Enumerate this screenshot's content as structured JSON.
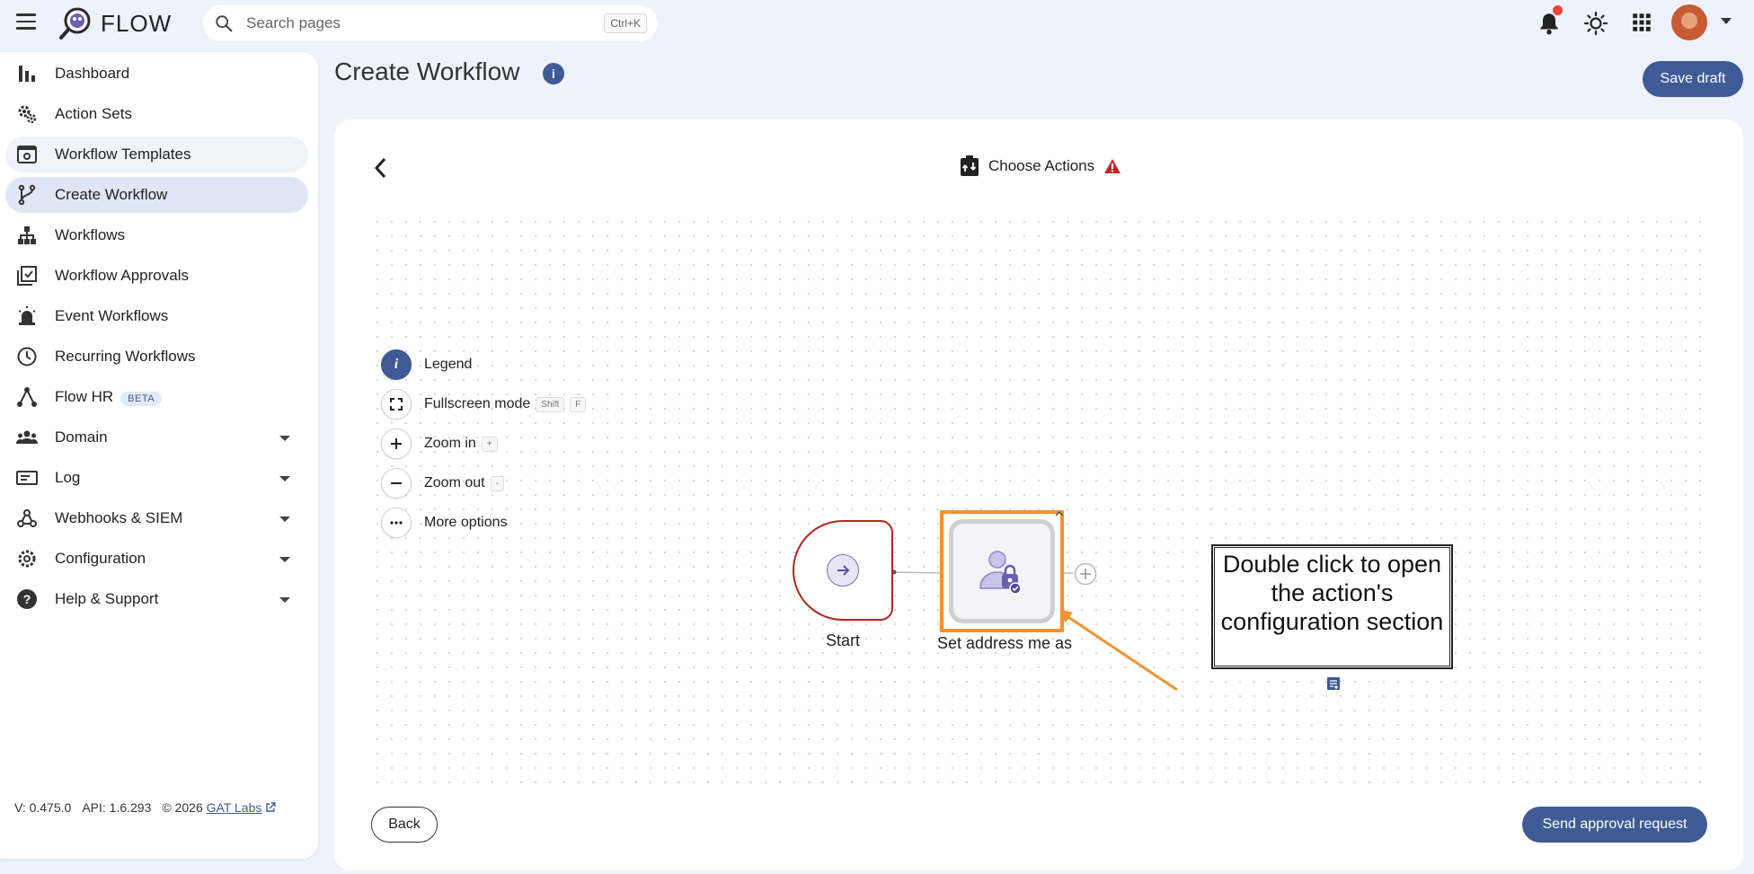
{
  "app": {
    "name": "FLOW"
  },
  "search": {
    "placeholder": "Search pages",
    "shortcut": "Ctrl+K"
  },
  "sidebar": {
    "items": [
      {
        "label": "Dashboard",
        "icon": "bar-chart-icon"
      },
      {
        "label": "Action Sets",
        "icon": "gears-icon"
      },
      {
        "label": "Workflow Templates",
        "icon": "template-icon"
      },
      {
        "label": "Create Workflow",
        "icon": "branch-icon"
      },
      {
        "label": "Workflows",
        "icon": "hierarchy-icon"
      },
      {
        "label": "Workflow Approvals",
        "icon": "approval-check-icon"
      },
      {
        "label": "Event Workflows",
        "icon": "alarm-light-icon"
      },
      {
        "label": "Recurring Workflows",
        "icon": "clock-icon"
      },
      {
        "label": "Flow HR",
        "icon": "network-icon",
        "badge": "BETA"
      },
      {
        "label": "Domain",
        "icon": "people-icon"
      },
      {
        "label": "Log",
        "icon": "log-icon"
      },
      {
        "label": "Webhooks & SIEM",
        "icon": "webhook-icon"
      },
      {
        "label": "Configuration",
        "icon": "gear-icon"
      },
      {
        "label": "Help & Support",
        "icon": "help-icon"
      }
    ],
    "active_index": 3,
    "footer": {
      "version": "V: 0.475.0",
      "api": "API: 1.6.293",
      "copyright": "© 2026",
      "company": "GAT Labs"
    }
  },
  "page": {
    "title": "Create Workflow",
    "save_draft": "Save draft"
  },
  "workflow": {
    "step_title": "Choose Actions",
    "controls": {
      "legend": "Legend",
      "fullscreen": "Fullscreen mode",
      "fullscreen_keys": [
        "Shift",
        "F"
      ],
      "zoom_in": "Zoom in",
      "zoom_in_key": "+",
      "zoom_out": "Zoom out",
      "zoom_out_key": "-",
      "more": "More options"
    },
    "start_label": "Start",
    "action_label": "Set address me as",
    "annotation": "Double click to open the action's configuration section"
  },
  "buttons": {
    "back": "Back",
    "send": "Send approval request"
  },
  "colors": {
    "primary": "#3e5b95",
    "warning": "#c62828",
    "start_border": "#b3261e",
    "highlight": "#f0942f"
  }
}
